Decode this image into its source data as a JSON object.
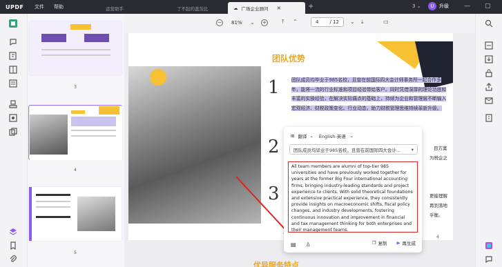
{
  "app": {
    "logo": "UPDF",
    "menu": [
      "文件",
      "帮助"
    ]
  },
  "tabs": [
    {
      "label": "运营助手",
      "active": false
    },
    {
      "label": "了不起的盖茨比",
      "active": false
    },
    {
      "label": "广场企业顾问",
      "active": true
    }
  ],
  "window": {
    "count": "3",
    "upgrade_label": "升级",
    "avatar_letter": "U"
  },
  "toolbar": {
    "zoom": "81%",
    "page_current": "4",
    "page_total": "/ 12"
  },
  "thumbnails": [
    {
      "num": "3"
    },
    {
      "num": "4"
    },
    {
      "num": "5"
    }
  ],
  "document": {
    "title": "团队优势",
    "numerals": [
      "1",
      "2",
      "3"
    ],
    "para1": "团队成员均毕业于985名校，且曾在前国际四大会计师事务所一起合作多年，能将一流的行业标准和项目经验带给客户。同时凭借深厚的理论功底和丰富的实操经验，在解决实际痛点的基础上，持续为企业和管理层不断输入宏观经济、财税政策变化、行业动态，助力财税管理思维持续革新升级。",
    "frag_right1": "目方案",
    "frag_right2": "为税企之",
    "frag_right3": "更能理解",
    "frag_right4": "再到落地",
    "frag_right5": "乎衡。",
    "page_num": "4",
    "bottom_title": "优异服务特点"
  },
  "popup": {
    "mode_label": "翻译",
    "language": "English-英语",
    "source_text": "团队成员均毕业于985名校，且曾在前国际四大会计...",
    "output_text": "All team members are alumni of top-tier 985 universities and have previously worked together for years at the former Big Four international accounting firms, bringing industry-leading standards and project experience to clients. With solid theoretical foundations and extensive practical experience, they consistently provide insights on macroeconomic shifts, fiscal policy changes, and industry developments, fostering continuous innovation and improvement in financial and tax management thinking for both enterprises and their management teams.",
    "copy_label": "复制",
    "regenerate_label": "再生成"
  },
  "colors": {
    "accent": "#8c5cf0",
    "title_yellow": "#e9a82a",
    "highlight": "#c8c3ee",
    "box_red": "#dd2222"
  }
}
